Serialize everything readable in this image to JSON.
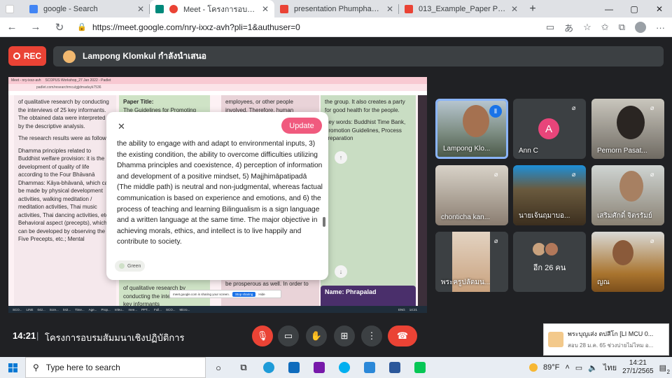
{
  "browser": {
    "tabs": [
      {
        "title": "google - Search",
        "fav": "#4285f4",
        "active": false
      },
      {
        "title": "Meet - โครงการอบรมสัมมนาเชิ",
        "fav": "#00897b",
        "active": true
      },
      {
        "title": "presentation Phumphakhawat ui",
        "fav": "#ea4335",
        "active": false
      },
      {
        "title": "013_Example_Paper Preparation",
        "fav": "#ea4335",
        "active": false
      }
    ],
    "url": "https://meet.google.com/nry-ixxz-avh?pli=1&authuser=0"
  },
  "meet": {
    "rec_label": "REC",
    "presenter": "Lampong Klomkul กำลังนำเสนอ",
    "time": "14:21",
    "meeting_title": "โครงการอบรมสัมมนาเชิงปฏิบัติการ"
  },
  "screen": {
    "mini_tabs": [
      "Meet - nry-ixxz-avh",
      "SCOPUS Workshop_27 Jan 2022 - Padlet"
    ],
    "mini_url": "padlet.com/researchmcu/gjjdmaduyk7536",
    "col1": [
      "of qualitative research by conducting the interviews of 25 key informants. The obtained data were interpreted by the descriptive analysis.",
      "The research results were as follows:",
      "Dhamma principles related to Buddhist welfare provision: it is the development of quality of life according to the Four Bhāvanā Dhammas: Kāya-bhāvanā, which can be made by physical development activities, walking meditation / meditation activities, Thai music activities, Thai dancing activities, etc.; Behavioral aspect (precepts), which can be developed by observing the Five Precepts, etc.; Mental"
    ],
    "col2_head": "Paper Title:",
    "col2": "The Guidelines for Promoting",
    "col2_bottom": "of qualitative research by conducting the interviews of 25 key informants",
    "col3": "employees, or other people involved. Therefore, human",
    "col3_bottom": "be prosperous as well. In order to have a family,",
    "col4": "the group. It also creates a party for good health for the people.",
    "col4_kw": "Key words: Buddhist Time Bank, Promotion Guidelines, Process preparation",
    "name_card": "Name: Phrapalad",
    "modal": {
      "update_label": "Update",
      "text": "the ability to engage with and adapt to environmental inputs, 3) the existing condition, the ability to overcome difficulties utilizing Dhamma principles and coexistence, 4) perception of information and development of a positive mindset, 5) Majjhimāpatipadā (The middle path) is neutral and non-judgmental, whereas factual communication is based on experience and emotions, and  6) the process of teaching and learning Bilingualism is a sign language and a written language at the same time. The major objective in achieving morals, ethics, and intellect is to live happily and contribute to society.",
      "tag": "Green"
    },
    "share_bar": {
      "text": "meet.google.com is sharing your screen.",
      "stop": "Stop sharing",
      "hide": "Hide"
    },
    "mini_taskbar": [
      "SCO...",
      "LINE",
      "042...",
      "Scre...",
      "042...",
      "Time...",
      "Age...",
      "Prop...",
      "releu...",
      "mee...",
      "PPT...",
      "Full...",
      "SCO...",
      "Micro...",
      "ENG",
      "14:21"
    ]
  },
  "participants": [
    {
      "name": "Lampong Klo...",
      "bg": "#6d7f88",
      "speaking": true
    },
    {
      "name": "Ann C",
      "bg": "#3c4043",
      "letter": "A"
    },
    {
      "name": "Pemorn Pasat...",
      "bg": "#8a8f8a"
    },
    {
      "name": "chonticha kan...",
      "bg": "#a8998a"
    },
    {
      "name": "นายเจ้นฤมาบอ...",
      "bg": "#6a5a3e"
    },
    {
      "name": "เสริมศักดิ์ จิตรรัมย์",
      "bg": "#8a8274"
    },
    {
      "name": "พระครูปลัดมน...",
      "bg": "#c9b8a6"
    },
    {
      "name": "อีก 26 คน",
      "bg": "#3c4043",
      "more": true
    },
    {
      "name": "ญณ",
      "bg": "#a9742e"
    }
  ],
  "notification": {
    "title": "พระบุญเส่ง ตปสีโก [LI MCU 0...",
    "sub": "สอบ 28 ม.ค. 65 ช่วงบ่ายไม่ไหม อ..."
  },
  "taskbar": {
    "search_placeholder": "Type here to search",
    "weather": "89°F",
    "lang": "ไทย",
    "time": "14:21",
    "date": "27/1/2565",
    "notif_count": "2"
  }
}
